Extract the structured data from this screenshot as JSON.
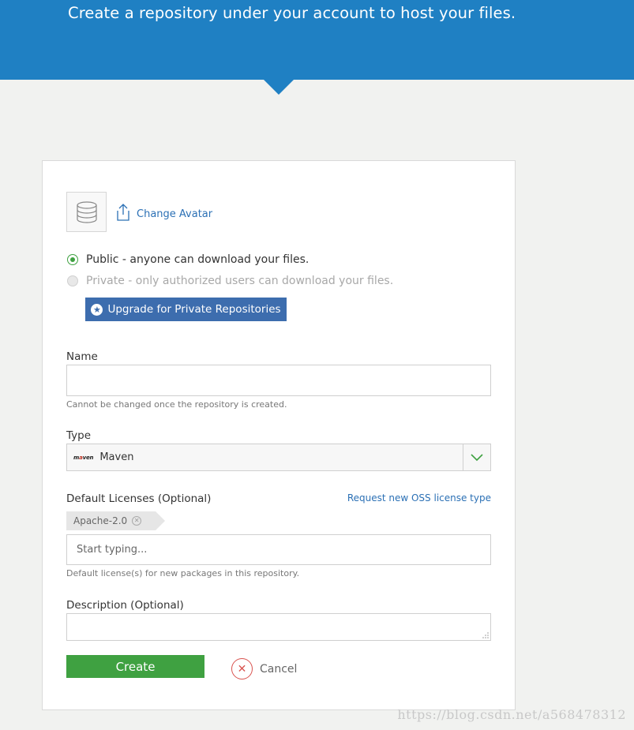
{
  "header": {
    "subtitle": "Create a repository under your account to host your files.",
    "banner_color": "#1f80c3"
  },
  "avatar": {
    "icon": "database-icon",
    "change_label": "Change Avatar",
    "change_icon": "upload-icon"
  },
  "visibility": {
    "public_label": "Public - anyone can download your files.",
    "private_label": "Private - only authorized users can download your files.",
    "selected": "public",
    "upgrade_label": "Upgrade for Private Repositories",
    "upgrade_icon": "star-circle-icon"
  },
  "name_field": {
    "label": "Name",
    "value": "",
    "help": "Cannot be changed once the repository is created."
  },
  "type_field": {
    "label": "Type",
    "value": "Maven",
    "logo_text_pre": "m",
    "logo_text_accent": "a",
    "logo_text_post": "ven",
    "dropdown_icon": "chevron-down-icon"
  },
  "licenses": {
    "label": "Default Licenses (Optional)",
    "request_link": "Request new OSS license type",
    "tags": [
      "Apache-2.0"
    ],
    "placeholder": "Start typing...",
    "help": "Default license(s) for new packages in this repository."
  },
  "description": {
    "label": "Description (Optional)",
    "value": ""
  },
  "actions": {
    "create_label": "Create",
    "cancel_label": "Cancel",
    "create_color": "#3fa141",
    "cancel_color": "#d9534f"
  },
  "watermark": "https://blog.csdn.net/a568478312"
}
